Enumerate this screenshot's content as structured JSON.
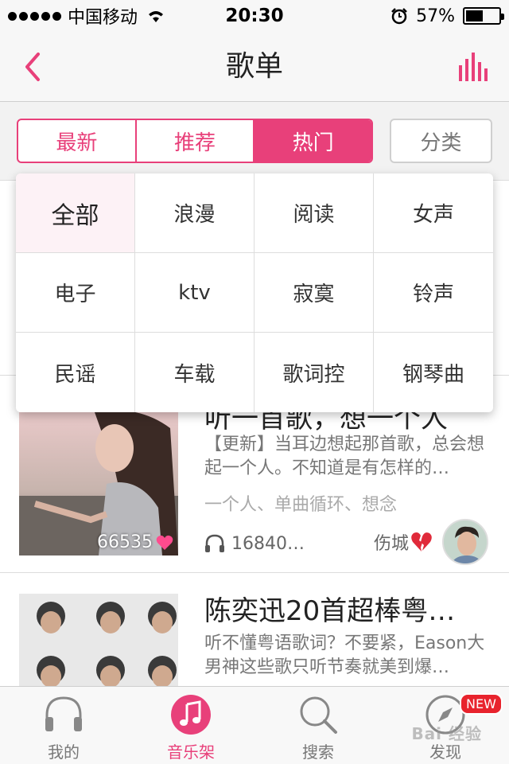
{
  "status_bar": {
    "carrier": "中国移动",
    "time": "20:30",
    "battery_text": "57%",
    "battery_level": 0.57
  },
  "nav": {
    "title": "歌单"
  },
  "segments": {
    "items": [
      "最新",
      "推荐",
      "热门"
    ],
    "active_index": 2,
    "category_button": "分类"
  },
  "dropdown": {
    "items": [
      "全部",
      "浪漫",
      "阅读",
      "女声",
      "电子",
      "ktv",
      "寂寞",
      "铃声",
      "民谣",
      "车载",
      "歌词控",
      "钢琴曲"
    ],
    "selected_index": 0
  },
  "playlists": [
    {
      "title": "听一首歌，想一个人",
      "description": "【更新】当耳边想起那首歌，总会想起一个人。不知道是有怎样的…",
      "tags": "一个人、单曲循环、想念",
      "likes": "66535",
      "plays": "16840…",
      "author": "伤城"
    },
    {
      "title": "陈奕迅20首超棒粤…",
      "description": "听不懂粤语歌词？不要紧，Eason大男神这些歌只听节奏就美到爆…"
    }
  ],
  "tabbar": {
    "tabs": [
      {
        "label": "我的",
        "icon": "headphones-icon"
      },
      {
        "label": "音乐架",
        "icon": "music-note-icon"
      },
      {
        "label": "搜索",
        "icon": "search-icon"
      },
      {
        "label": "发现",
        "icon": "compass-icon"
      }
    ],
    "active_index": 1,
    "new_badge": "NEW"
  },
  "watermark": "Bai 经验",
  "colors": {
    "accent": "#e8407a",
    "badge_red": "#e8232d"
  }
}
